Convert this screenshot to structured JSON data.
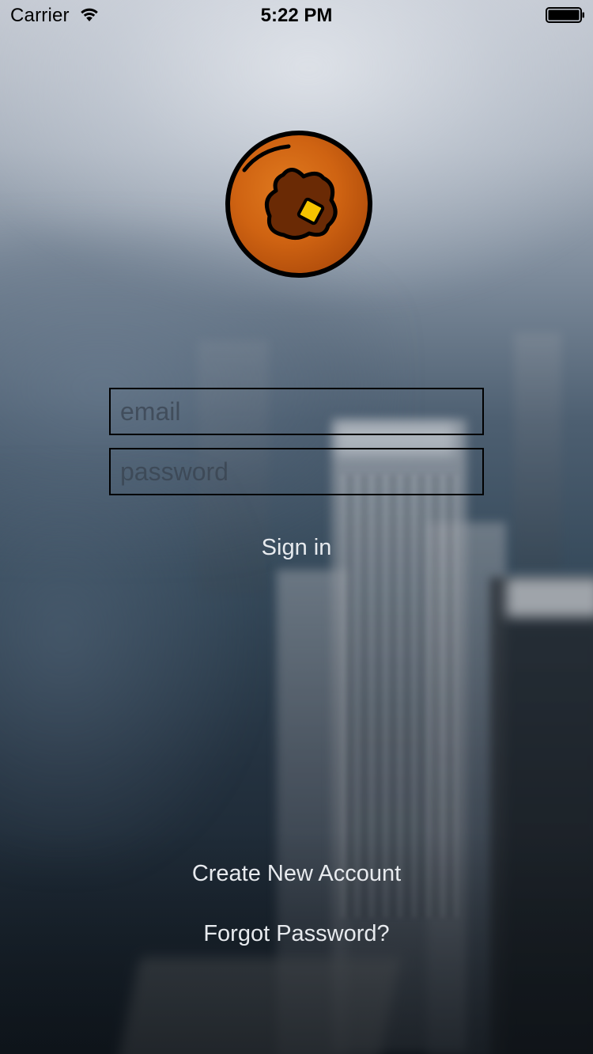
{
  "status_bar": {
    "carrier": "Carrier",
    "time": "5:22 PM",
    "wifi_icon": "wifi-icon",
    "battery_icon": "battery-icon"
  },
  "logo": {
    "icon": "pancake-logo-icon",
    "colors": {
      "outer": "#c45a10",
      "inner_dark": "#6a2a05",
      "butter": "#f5c400",
      "outline": "#000000"
    }
  },
  "login": {
    "email_placeholder": "email",
    "password_placeholder": "password",
    "sign_in_label": "Sign in"
  },
  "footer": {
    "create_account_label": "Create New Account",
    "forgot_password_label": "Forgot Password?"
  }
}
